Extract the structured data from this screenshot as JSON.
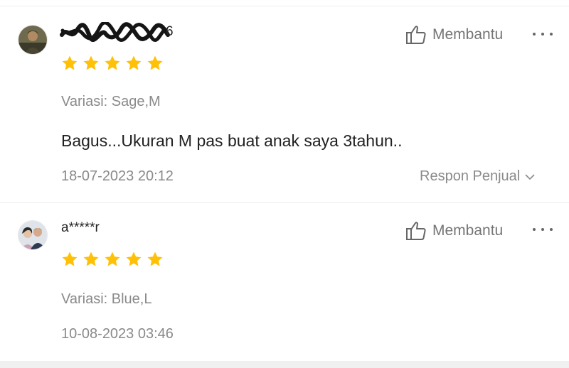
{
  "colors": {
    "star": "#ffc107",
    "muted_text": "#8a8a8a",
    "body_text": "#212121",
    "divider": "#ececec"
  },
  "reviews": [
    {
      "username": "6",
      "username_redacted": true,
      "rating": 5,
      "helpful_label": "Membantu",
      "variation": "Variasi: Sage,M",
      "comment": "Bagus...Ukuran M pas buat anak saya 3tahun..",
      "timestamp": "18-07-2023 20:12",
      "seller_reply_label": "Respon Penjual",
      "icons": {
        "helpful": "thumbs-up-icon",
        "more": "more-dots-icon",
        "reply_toggle": "chevron-down-icon",
        "star": "star-icon"
      }
    },
    {
      "username": "a*****r",
      "rating": 5,
      "helpful_label": "Membantu",
      "variation": "Variasi: Blue,L",
      "timestamp": "10-08-2023 03:46",
      "icons": {
        "helpful": "thumbs-up-icon",
        "more": "more-dots-icon",
        "star": "star-icon"
      }
    }
  ]
}
